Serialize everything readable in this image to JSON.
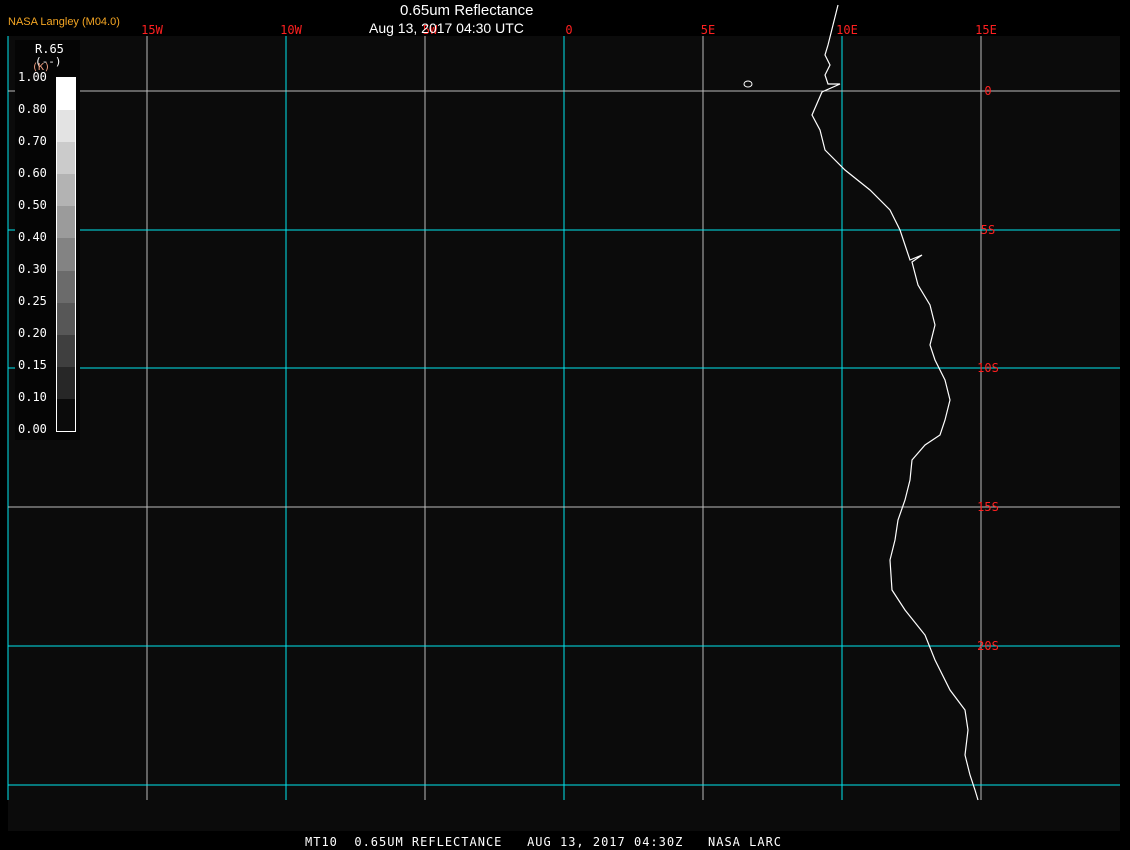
{
  "header": {
    "title": "0.65um Reflectance",
    "subtitle": "Aug 13, 2017 04:30 UTC",
    "org": "NASA Langley (M04.0)"
  },
  "footer": "MT10  0.65UM REFLECTANCE   AUG 13, 2017 04:30Z   NASA LARC",
  "legend": {
    "var": "R.65",
    "units": "(--)",
    "units2": "(K)",
    "ticks": [
      "1.00",
      "0.80",
      "0.70",
      "0.60",
      "0.50",
      "0.40",
      "0.30",
      "0.25",
      "0.20",
      "0.15",
      "0.10",
      "0.00"
    ],
    "colors": [
      "#ffffff",
      "#e3e3e3",
      "#cbcbcb",
      "#b3b3b3",
      "#9b9b9b",
      "#838383",
      "#6b6b6b",
      "#575757",
      "#3f3f3f",
      "#272727",
      "#0b0b0b"
    ]
  },
  "grid": {
    "lon_labels": [
      "15W",
      "10W",
      "5W",
      "0",
      "5E",
      "10E",
      "15E"
    ],
    "lat_labels": [
      "0",
      "5S",
      "10S",
      "15S",
      "20S"
    ],
    "label_color": "#ff2020",
    "grid_color": "#00e5ee"
  }
}
